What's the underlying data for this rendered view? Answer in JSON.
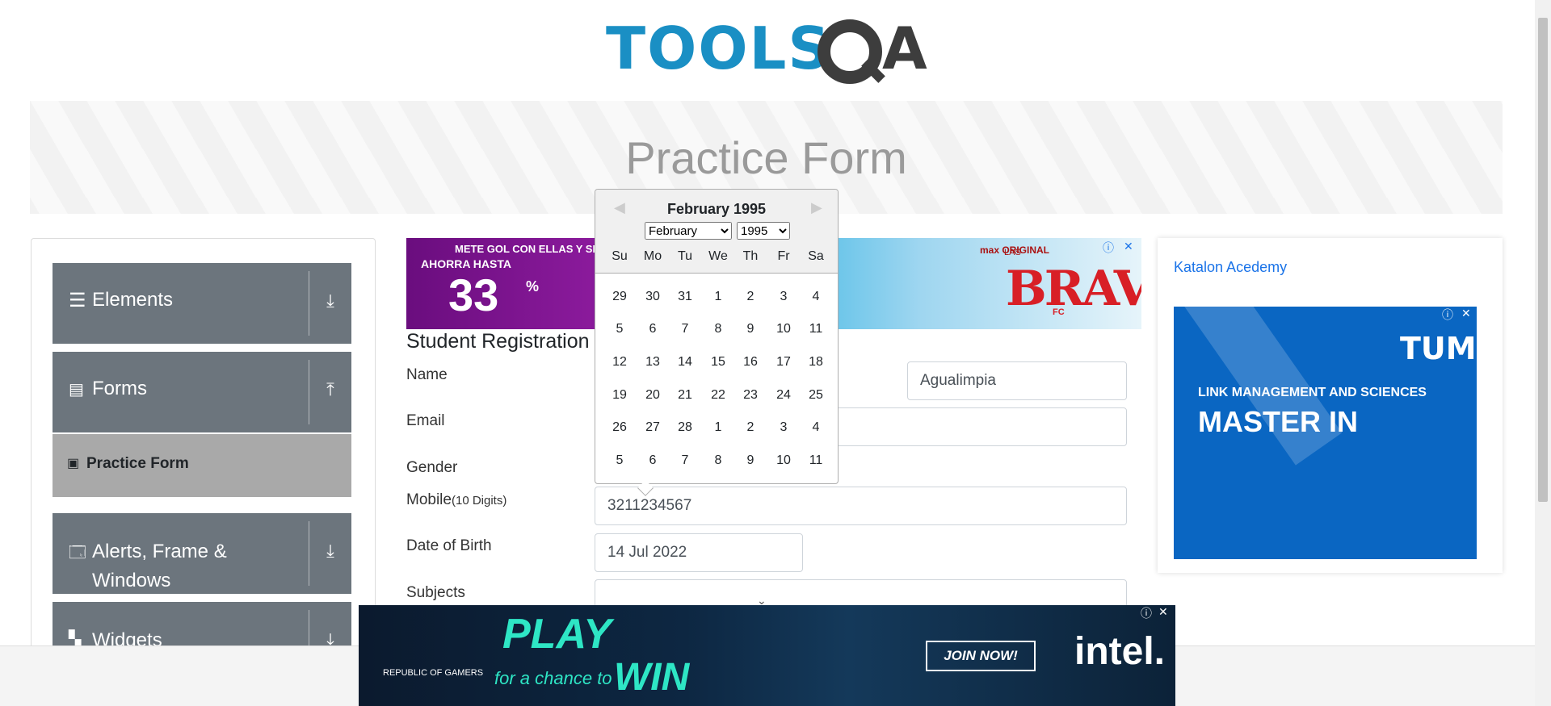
{
  "logo": {
    "text_left": "TOOLS",
    "text_right": "A"
  },
  "page_title": "Practice Form",
  "sidebar": {
    "groups": [
      {
        "label": "Elements",
        "icon": "hamburger-icon",
        "arrow": "⤓"
      },
      {
        "label": "Forms",
        "icon": "document-icon",
        "arrow": "⤒"
      },
      {
        "label": "Alerts, Frame &",
        "label2": "Windows",
        "icon": "window-icon",
        "arrow": "⤓"
      },
      {
        "label": "Widgets",
        "icon": "widgets-icon",
        "arrow": "⤓"
      }
    ],
    "sub_item": {
      "label": "Practice Form",
      "icon": "html5-icon"
    }
  },
  "ad_top": {
    "t1": "METE GOL CON ELLAS Y SE",
    "t2": "AHORRA HASTA",
    "t3": "33",
    "t4": "%",
    "t5": "max ORIGINAL",
    "t6": "LAS",
    "t7": "BRAVAS",
    "t8": "FC",
    "info": "ⓘ",
    "close": "✕"
  },
  "form": {
    "title": "Student Registration",
    "name_label": "Name",
    "last_name_value": "Agualimpia",
    "email_label": "Email",
    "gender_label": "Gender",
    "mobile_label": "Mobile",
    "mobile_hint": "(10 Digits)",
    "mobile_value": "3211234567",
    "dob_label": "Date of Birth",
    "dob_value": "14 Jul 2022",
    "subjects_label": "Subjects"
  },
  "calendar": {
    "title": "February 1995",
    "month_select": "February",
    "year_select": "1995",
    "prev": "◀",
    "next": "▶",
    "weekdays": [
      "Su",
      "Mo",
      "Tu",
      "We",
      "Th",
      "Fr",
      "Sa"
    ],
    "weeks": [
      [
        "29",
        "30",
        "31",
        "1",
        "2",
        "3",
        "4"
      ],
      [
        "5",
        "6",
        "7",
        "8",
        "9",
        "10",
        "11"
      ],
      [
        "12",
        "13",
        "14",
        "15",
        "16",
        "17",
        "18"
      ],
      [
        "19",
        "20",
        "21",
        "22",
        "23",
        "24",
        "25"
      ],
      [
        "26",
        "27",
        "28",
        "1",
        "2",
        "3",
        "4"
      ],
      [
        "5",
        "6",
        "7",
        "8",
        "9",
        "10",
        "11"
      ]
    ]
  },
  "right_ad": {
    "katalon_alt": "Katalon Acedemy",
    "tum_logo": "TUM",
    "line1": "LINK MANAGEMENT AND SCIENCES",
    "line2": "MASTER IN",
    "info": "ⓘ",
    "close": "✕"
  },
  "ad_bottom": {
    "rog": "REPUBLIC OF GAMERS",
    "play": "PLAY",
    "chance": "for a chance to",
    "win": "WIN",
    "join": "JOIN NOW!",
    "intel": "intel.",
    "info": "ⓘ",
    "close": "✕"
  }
}
